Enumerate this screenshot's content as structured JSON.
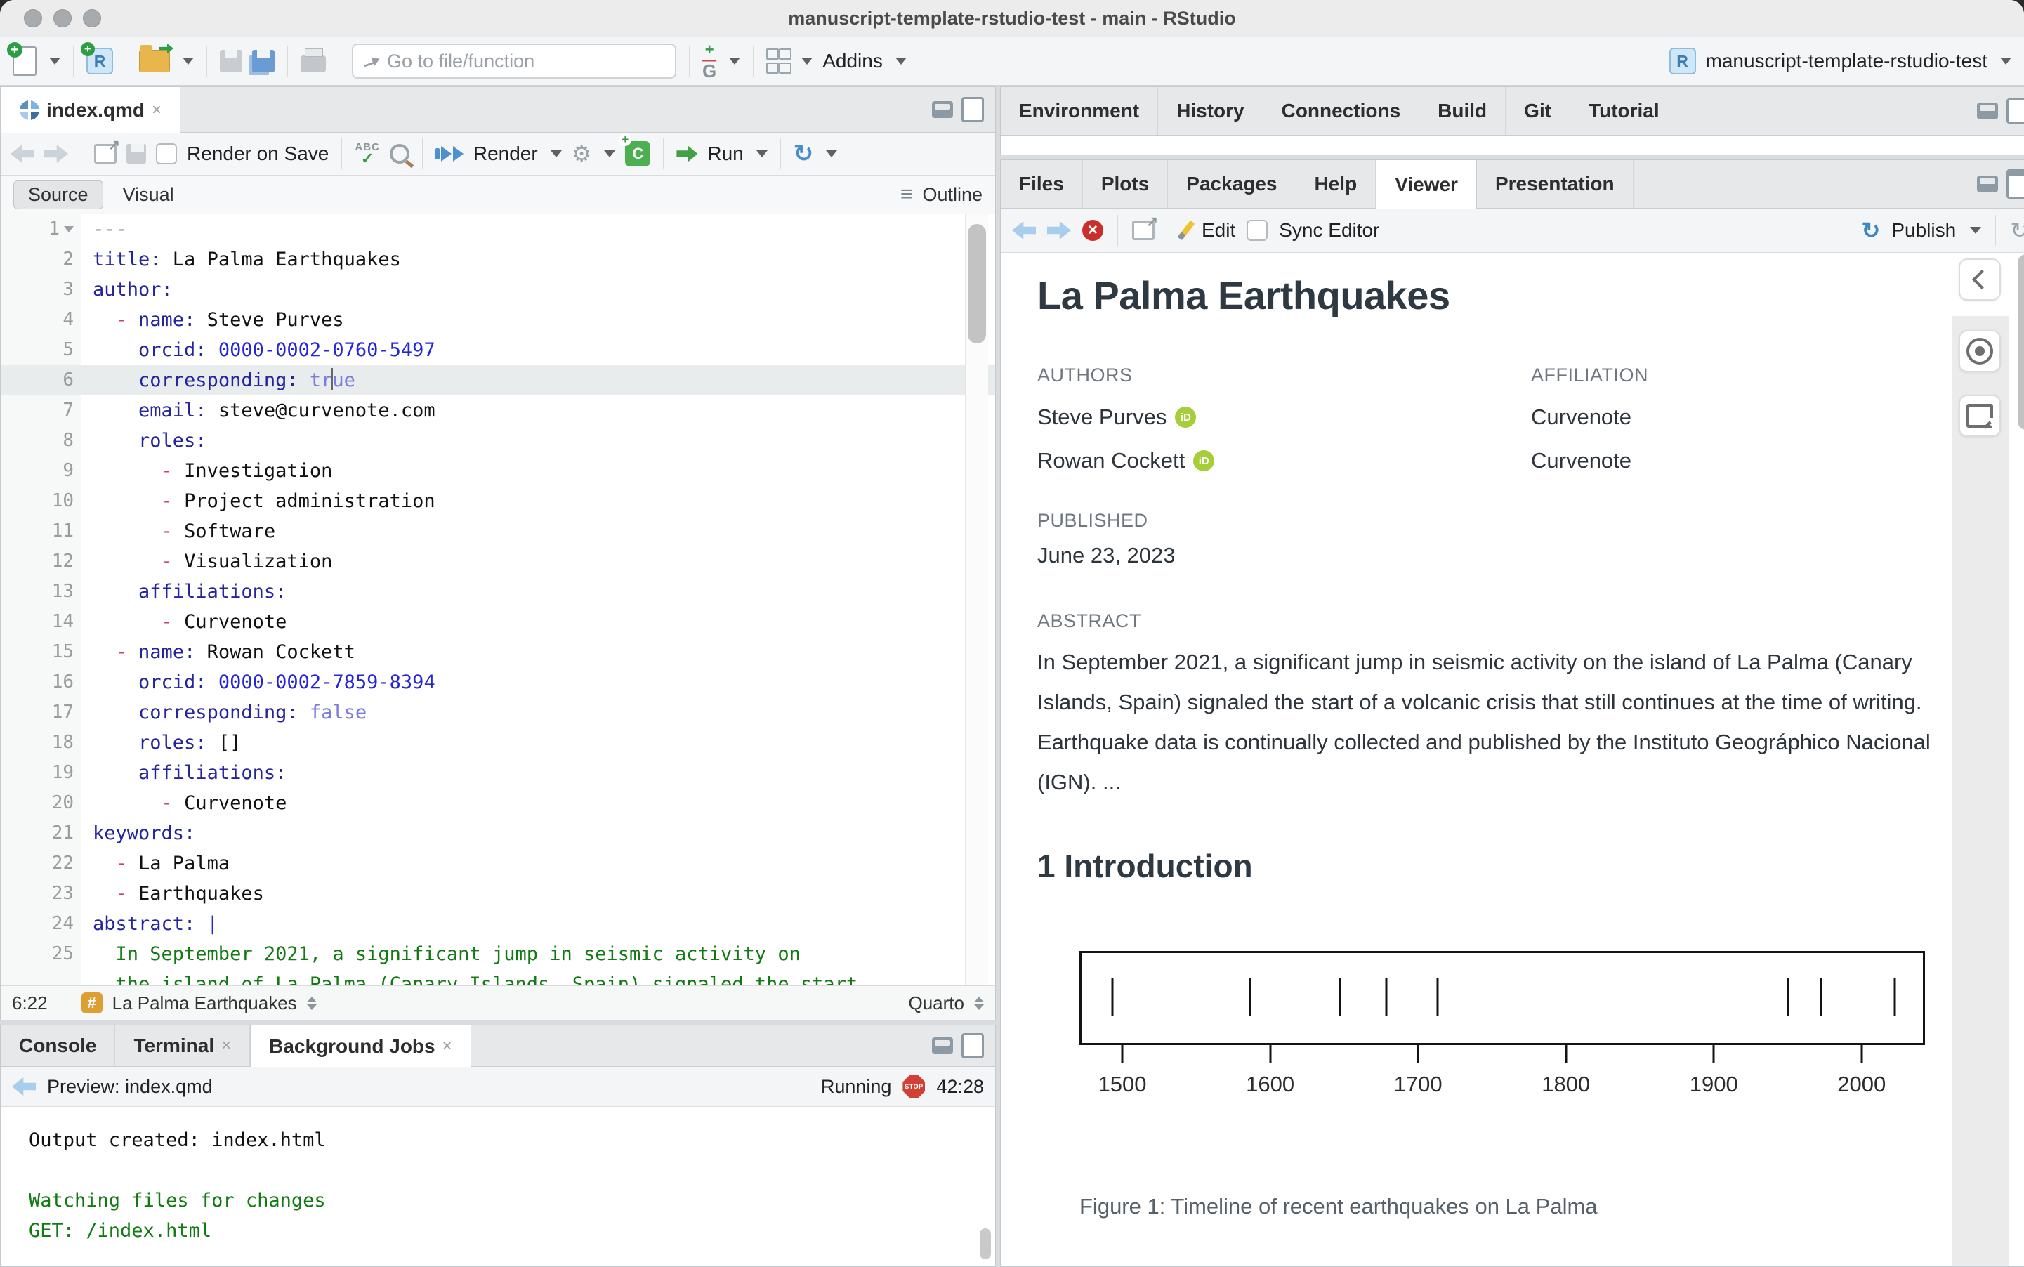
{
  "window": {
    "title": "manuscript-template-rstudio-test - main - RStudio"
  },
  "toolbar": {
    "goto_placeholder": "Go to file/function",
    "addins_label": "Addins",
    "project_name": "manuscript-template-rstudio-test"
  },
  "editor": {
    "tab_label": "index.qmd",
    "render_on_save_label": "Render on Save",
    "render_label": "Render",
    "run_label": "Run",
    "source_label": "Source",
    "visual_label": "Visual",
    "outline_label": "Outline",
    "status": {
      "cursor_position": "6:22",
      "section": "La Palma Earthquakes",
      "mode": "Quarto"
    },
    "lines": [
      {
        "n": "1",
        "fold": true,
        "segs": [
          [
            "m",
            "---"
          ]
        ]
      },
      {
        "n": "2",
        "segs": [
          [
            "k",
            "title:"
          ],
          [
            "v",
            " La Palma Earthquakes"
          ]
        ]
      },
      {
        "n": "3",
        "segs": [
          [
            "k",
            "author:"
          ]
        ]
      },
      {
        "n": "4",
        "segs": [
          [
            "v",
            "  "
          ],
          [
            "d",
            "-"
          ],
          [
            "v",
            " "
          ],
          [
            "k",
            "name:"
          ],
          [
            "v",
            " Steve Purves"
          ]
        ]
      },
      {
        "n": "5",
        "segs": [
          [
            "v",
            "    "
          ],
          [
            "k",
            "orcid:"
          ],
          [
            "v",
            " "
          ],
          [
            "n2",
            "0000-0002-0760-5497"
          ]
        ]
      },
      {
        "n": "6",
        "hl": true,
        "segs": [
          [
            "v",
            "    "
          ],
          [
            "k",
            "corresponding:"
          ],
          [
            "v",
            " "
          ],
          [
            "b",
            "tr"
          ],
          [
            "caret",
            ""
          ],
          [
            "b",
            "ue"
          ]
        ]
      },
      {
        "n": "7",
        "segs": [
          [
            "v",
            "    "
          ],
          [
            "k",
            "email:"
          ],
          [
            "v",
            " steve@curvenote.com"
          ]
        ]
      },
      {
        "n": "8",
        "segs": [
          [
            "v",
            "    "
          ],
          [
            "k",
            "roles:"
          ]
        ]
      },
      {
        "n": "9",
        "segs": [
          [
            "v",
            "      "
          ],
          [
            "d",
            "-"
          ],
          [
            "v",
            " Investigation"
          ]
        ]
      },
      {
        "n": "10",
        "segs": [
          [
            "v",
            "      "
          ],
          [
            "d",
            "-"
          ],
          [
            "v",
            " Project administration"
          ]
        ]
      },
      {
        "n": "11",
        "segs": [
          [
            "v",
            "      "
          ],
          [
            "d",
            "-"
          ],
          [
            "v",
            " Software"
          ]
        ]
      },
      {
        "n": "12",
        "segs": [
          [
            "v",
            "      "
          ],
          [
            "d",
            "-"
          ],
          [
            "v",
            " Visualization"
          ]
        ]
      },
      {
        "n": "13",
        "segs": [
          [
            "v",
            "    "
          ],
          [
            "k",
            "affiliations:"
          ]
        ]
      },
      {
        "n": "14",
        "segs": [
          [
            "v",
            "      "
          ],
          [
            "d",
            "-"
          ],
          [
            "v",
            " Curvenote"
          ]
        ]
      },
      {
        "n": "15",
        "segs": [
          [
            "v",
            "  "
          ],
          [
            "d",
            "-"
          ],
          [
            "v",
            " "
          ],
          [
            "k",
            "name:"
          ],
          [
            "v",
            " Rowan Cockett"
          ]
        ]
      },
      {
        "n": "16",
        "segs": [
          [
            "v",
            "    "
          ],
          [
            "k",
            "orcid:"
          ],
          [
            "v",
            " "
          ],
          [
            "n2",
            "0000-0002-7859-8394"
          ]
        ]
      },
      {
        "n": "17",
        "segs": [
          [
            "v",
            "    "
          ],
          [
            "k",
            "corresponding:"
          ],
          [
            "v",
            " "
          ],
          [
            "b",
            "false"
          ]
        ]
      },
      {
        "n": "18",
        "segs": [
          [
            "v",
            "    "
          ],
          [
            "k",
            "roles:"
          ],
          [
            "v",
            " []"
          ]
        ]
      },
      {
        "n": "19",
        "segs": [
          [
            "v",
            "    "
          ],
          [
            "k",
            "affiliations:"
          ]
        ]
      },
      {
        "n": "20",
        "segs": [
          [
            "v",
            "      "
          ],
          [
            "d",
            "-"
          ],
          [
            "v",
            " Curvenote"
          ]
        ]
      },
      {
        "n": "21",
        "segs": [
          [
            "k",
            "keywords:"
          ]
        ]
      },
      {
        "n": "22",
        "segs": [
          [
            "v",
            "  "
          ],
          [
            "d",
            "-"
          ],
          [
            "v",
            " La Palma"
          ]
        ]
      },
      {
        "n": "23",
        "segs": [
          [
            "v",
            "  "
          ],
          [
            "d",
            "-"
          ],
          [
            "v",
            " Earthquakes"
          ]
        ]
      },
      {
        "n": "24",
        "segs": [
          [
            "k",
            "abstract:"
          ],
          [
            "v",
            " "
          ],
          [
            "n2",
            "|"
          ]
        ]
      },
      {
        "n": "25",
        "segs": [
          [
            "g",
            "  In September 2021, a significant jump in seismic activity on"
          ]
        ]
      },
      {
        "n": "",
        "segs": [
          [
            "g",
            "  the island of La Palma (Canary Islands, Spain) signaled the start"
          ]
        ]
      }
    ]
  },
  "console": {
    "tabs": [
      {
        "label": "Console",
        "close": false,
        "active": false
      },
      {
        "label": "Terminal",
        "close": true,
        "active": false
      },
      {
        "label": "Background Jobs",
        "close": true,
        "active": true
      }
    ],
    "preview_label": "Preview: index.qmd",
    "running_label": "Running",
    "stop_label": "STOP",
    "elapsed": "42:28",
    "output": [
      {
        "text": "Output created: index.html",
        "color": "plain"
      },
      {
        "text": "",
        "color": "plain"
      },
      {
        "text": "Watching files for changes",
        "color": "green"
      },
      {
        "text": "GET: /index.html",
        "color": "green"
      }
    ]
  },
  "right": {
    "top_tabs": [
      "Environment",
      "History",
      "Connections",
      "Build",
      "Git",
      "Tutorial"
    ],
    "viewer_tabs": [
      "Files",
      "Plots",
      "Packages",
      "Help",
      "Viewer",
      "Presentation"
    ],
    "viewer_active_index": 4,
    "edit_label": "Edit",
    "sync_editor_label": "Sync Editor",
    "publish_label": "Publish"
  },
  "article": {
    "title": "La Palma Earthquakes",
    "authors_label": "AUTHORS",
    "affiliation_label": "AFFILIATION",
    "orcid_icon_label": "iD",
    "authors": [
      {
        "name": "Steve Purves",
        "affiliation": "Curvenote"
      },
      {
        "name": "Rowan Cockett",
        "affiliation": "Curvenote"
      }
    ],
    "published_label": "PUBLISHED",
    "published_date": "June 23, 2023",
    "abstract_label": "ABSTRACT",
    "abstract_text": "In September 2021, a significant jump in seismic activity on the island of La Palma (Canary Islands, Spain) signaled the start of a volcanic crisis that still continues at the time of writing. Earthquake data is continually collected and published by the Instituto Geográphico Nacional (IGN). ...",
    "section_heading": "1 Introduction",
    "figure_caption": "Figure 1: Timeline of recent earthquakes on La Palma"
  },
  "chart_data": {
    "type": "scatter",
    "title": "Timeline of recent earthquakes on La Palma",
    "description": "Rug/timeline plot: one vertical tick per eruption year inside a framed box, x axis in years",
    "events": [
      1492,
      1585,
      1646,
      1677,
      1712,
      1949,
      1971,
      2021
    ],
    "x_ticks": [
      1500,
      1600,
      1700,
      1800,
      1900,
      2000
    ],
    "xlim": [
      1471,
      2040
    ],
    "xlabel": "",
    "ylabel": "",
    "grid": false,
    "legend": "none"
  }
}
